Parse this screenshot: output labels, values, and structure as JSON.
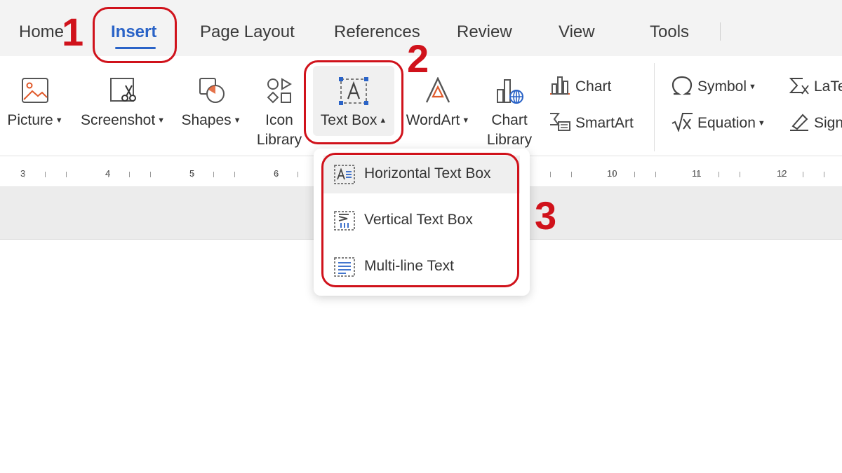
{
  "tabs": [
    {
      "label": "Home"
    },
    {
      "label": "Insert"
    },
    {
      "label": "Page Layout"
    },
    {
      "label": "References"
    },
    {
      "label": "Review"
    },
    {
      "label": "View"
    },
    {
      "label": "Tools"
    }
  ],
  "active_tab": "Insert",
  "ribbon": {
    "picture": "Picture",
    "screenshot": "Screenshot",
    "shapes": "Shapes",
    "icon_library_1": "Icon",
    "icon_library_2": "Library",
    "text_box": "Text Box",
    "wordart": "WordArt",
    "chart_library_1": "Chart",
    "chart_library_2": "Library",
    "chart": "Chart",
    "smartart": "SmartArt",
    "symbol": "Symbol",
    "equation": "Equation",
    "latex": "LaTe",
    "signature": "Sign"
  },
  "ruler_numbers": [
    "3",
    "4",
    "5",
    "6",
    "10",
    "11",
    "12"
  ],
  "dropdown": {
    "items": [
      {
        "label": "Horizontal Text Box"
      },
      {
        "label": "Vertical Text Box"
      },
      {
        "label": "Multi-line Text"
      }
    ]
  },
  "annotations": {
    "step1": "1",
    "step2": "2",
    "step3": "3"
  },
  "colors": {
    "accent": "#2a63c7",
    "highlight": "#d0121b"
  }
}
